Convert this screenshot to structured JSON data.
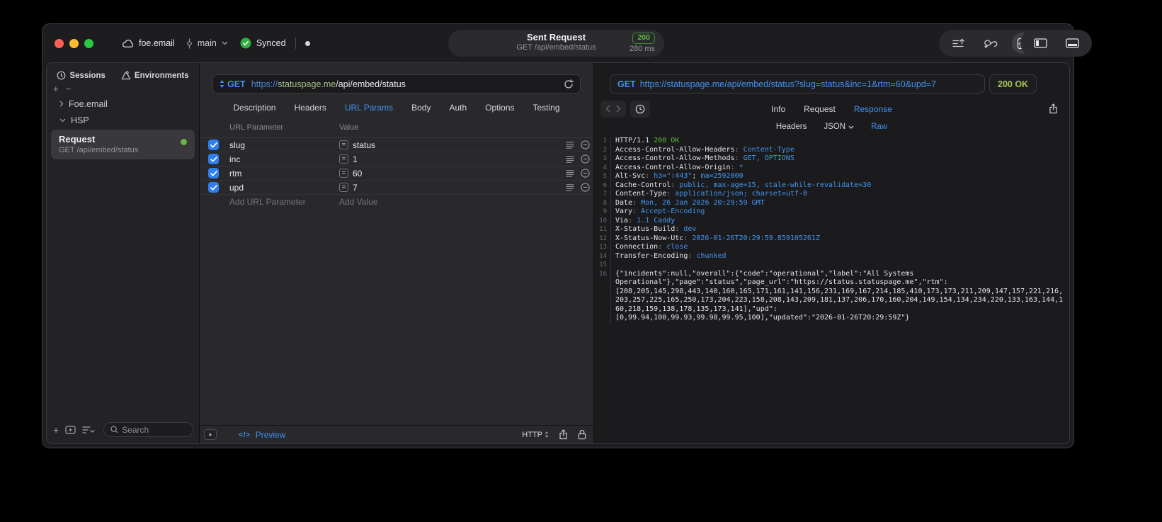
{
  "titlebar": {
    "cloud_label": "foe.email",
    "branch": "main",
    "sync_label": "Synced",
    "center": {
      "title": "Sent Request",
      "subtitle": "GET /api/embed/status",
      "status_code": "200",
      "duration": "280 ms"
    }
  },
  "sidebar": {
    "tabs": [
      {
        "label": "Sessions"
      },
      {
        "label": "Environments"
      }
    ],
    "tree": [
      {
        "label": "Foe.email",
        "expanded": false
      },
      {
        "label": "HSP",
        "expanded": true
      }
    ],
    "request_item": {
      "title": "Request",
      "subtitle": "GET /api/embed/status"
    },
    "search_placeholder": "Search"
  },
  "editor": {
    "method": "GET",
    "url": {
      "scheme": "https://",
      "host": "statuspage.me",
      "path": "/api/embed/status"
    },
    "tabs": [
      "Description",
      "Headers",
      "URL Params",
      "Body",
      "Auth",
      "Options",
      "Testing"
    ],
    "active_tab": "URL Params",
    "table": {
      "col_param": "URL Parameter",
      "col_value": "Value",
      "rows": [
        {
          "name": "slug",
          "value": "status",
          "enabled": true
        },
        {
          "name": "inc",
          "value": "1",
          "enabled": true
        },
        {
          "name": "rtm",
          "value": "60",
          "enabled": true
        },
        {
          "name": "upd",
          "value": "7",
          "enabled": true
        }
      ],
      "add_param": "Add URL Parameter",
      "add_value": "Add Value"
    },
    "footer": {
      "code_glyph": "</>",
      "preview": "Preview",
      "protocol": "HTTP"
    }
  },
  "viewer": {
    "method": "GET",
    "url": "https://statuspage.me/api/embed/status?slug=status&inc=1&rtm=60&upd=7",
    "status": "200 OK",
    "tabs": [
      "Info",
      "Request",
      "Response"
    ],
    "active_tab": "Response",
    "subtabs": [
      "Headers",
      "JSON",
      "Raw"
    ],
    "active_subtab": "Raw",
    "response_lines": [
      {
        "n": "1",
        "parts": [
          {
            "t": "HTTP/1.1 ",
            "c": "p"
          },
          {
            "t": "200 OK",
            "c": "g"
          }
        ]
      },
      {
        "n": "2",
        "parts": [
          {
            "t": "Access-Control-Allow-Headers",
            "c": "p"
          },
          {
            "t": ": ",
            "c": "s"
          },
          {
            "t": "Content-Type",
            "c": "v"
          }
        ]
      },
      {
        "n": "3",
        "parts": [
          {
            "t": "Access-Control-Allow-Methods",
            "c": "p"
          },
          {
            "t": ": ",
            "c": "s"
          },
          {
            "t": "GET, OPTIONS",
            "c": "v"
          }
        ]
      },
      {
        "n": "4",
        "parts": [
          {
            "t": "Access-Control-Allow-Origin",
            "c": "p"
          },
          {
            "t": ": ",
            "c": "s"
          },
          {
            "t": "*",
            "c": "v"
          }
        ]
      },
      {
        "n": "5",
        "parts": [
          {
            "t": "Alt-Svc",
            "c": "p"
          },
          {
            "t": ": ",
            "c": "s"
          },
          {
            "t": "h3=\":443\"",
            "c": "v"
          },
          {
            "t": "; ",
            "c": "p"
          },
          {
            "t": "ma=2592000",
            "c": "v"
          }
        ]
      },
      {
        "n": "6",
        "parts": [
          {
            "t": "Cache-Control",
            "c": "p"
          },
          {
            "t": ": ",
            "c": "s"
          },
          {
            "t": "public, max-age=15, stale-while-revalidate=30",
            "c": "v"
          }
        ]
      },
      {
        "n": "7",
        "parts": [
          {
            "t": "Content-Type",
            "c": "p"
          },
          {
            "t": ": ",
            "c": "s"
          },
          {
            "t": "application/json; charset=utf-8",
            "c": "v"
          }
        ]
      },
      {
        "n": "8",
        "parts": [
          {
            "t": "Date",
            "c": "p"
          },
          {
            "t": ": ",
            "c": "s"
          },
          {
            "t": "Mon, 26 Jan 2026 20:29:59 GMT",
            "c": "v"
          }
        ]
      },
      {
        "n": "9",
        "parts": [
          {
            "t": "Vary",
            "c": "p"
          },
          {
            "t": ": ",
            "c": "s"
          },
          {
            "t": "Accept-Encoding",
            "c": "v"
          }
        ]
      },
      {
        "n": "10",
        "parts": [
          {
            "t": "Via",
            "c": "p"
          },
          {
            "t": ": ",
            "c": "s"
          },
          {
            "t": "1.1 Caddy",
            "c": "v"
          }
        ]
      },
      {
        "n": "11",
        "parts": [
          {
            "t": "X-Status-Build",
            "c": "p"
          },
          {
            "t": ": ",
            "c": "s"
          },
          {
            "t": "dev",
            "c": "v"
          }
        ]
      },
      {
        "n": "12",
        "parts": [
          {
            "t": "X-Status-Now-Utc",
            "c": "p"
          },
          {
            "t": ": ",
            "c": "s"
          },
          {
            "t": "2026-01-26T20:29:59.859105261Z",
            "c": "v"
          }
        ]
      },
      {
        "n": "13",
        "parts": [
          {
            "t": "Connection",
            "c": "p"
          },
          {
            "t": ": ",
            "c": "s"
          },
          {
            "t": "close",
            "c": "v"
          }
        ]
      },
      {
        "n": "14",
        "parts": [
          {
            "t": "Transfer-Encoding",
            "c": "p"
          },
          {
            "t": ": ",
            "c": "s"
          },
          {
            "t": "chunked",
            "c": "v"
          }
        ]
      },
      {
        "n": "15",
        "parts": []
      },
      {
        "n": "16",
        "parts": [
          {
            "t": "{\"incidents\":null,\"overall\":{\"code\":\"operational\",\"label\":\"All Systems",
            "c": "p"
          }
        ]
      },
      {
        "n": "",
        "parts": [
          {
            "t": "Operational\"},\"page\":\"status\",\"page_url\":\"https://status.statuspage.me\",\"rtm\":",
            "c": "p"
          }
        ]
      },
      {
        "n": "",
        "parts": [
          {
            "t": "[208,205,145,298,443,140,160,165,171,161,141,156,231,169,167,214,185,410,173,173,211,209,147,157,221,216,",
            "c": "p"
          }
        ]
      },
      {
        "n": "",
        "parts": [
          {
            "t": "203,257,225,165,250,173,204,223,158,208,143,209,181,137,206,170,160,204,149,154,134,234,220,133,163,144,1",
            "c": "p"
          }
        ]
      },
      {
        "n": "",
        "parts": [
          {
            "t": "60,218,159,138,178,135,173,141],\"upd\":",
            "c": "p"
          }
        ]
      },
      {
        "n": "",
        "parts": [
          {
            "t": "[0,99.94,100,99.93,99.98,99.95,100],\"updated\":\"2026-01-26T20:29:59Z\"}",
            "c": "p"
          }
        ]
      }
    ]
  },
  "colors": {
    "accent_blue": "#4090f0",
    "value_blue": "#4295f0",
    "status_green": "#58bb3c",
    "badge_green": "#a8c455",
    "host_green": "#a3bd8a",
    "checkbox_blue": "#2e7ef0",
    "request_dot_green": "#67b546"
  }
}
